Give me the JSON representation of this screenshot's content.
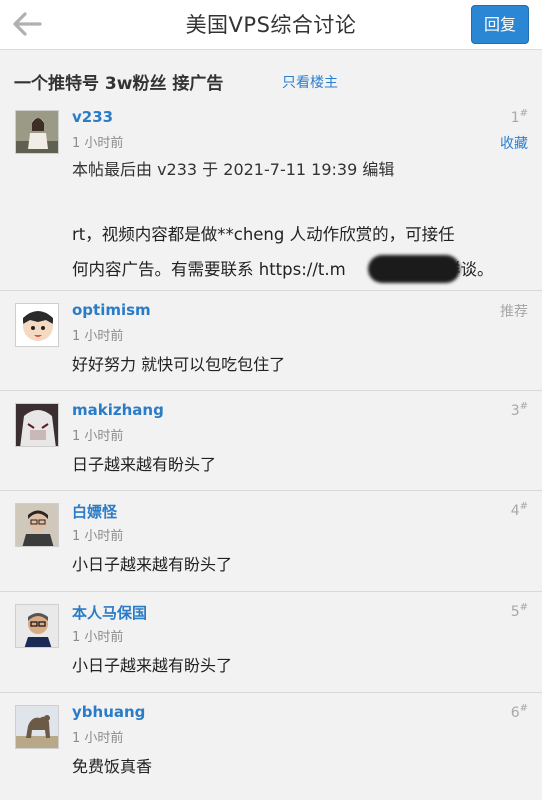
{
  "header": {
    "title": "美国VPS综合讨论",
    "reply_label": "回复",
    "back_icon": "back-arrow-icon"
  },
  "thread": {
    "title": "一个推特号 3w粉丝 接广告",
    "only_op_label": "只看楼主"
  },
  "posts": [
    {
      "author": "v233",
      "time": "1 小时前",
      "floor": "1",
      "action": "收藏",
      "edit_note": "本帖最后由 v233 于 2021-7-11 19:39 编辑",
      "body_line1": "rt，视频内容都是做**cheng 人动作欣赏的，可接任",
      "body_line2": "何内容广告。有需要联系 https://t.m",
      "body_line2_end": "详谈。"
    },
    {
      "author": "optimism",
      "time": "1 小时前",
      "floor": "推荐",
      "content": "好好努力 就快可以包吃包住了"
    },
    {
      "author": "makizhang",
      "time": "1 小时前",
      "floor": "3",
      "content": "日子越来越有盼头了"
    },
    {
      "author": "白嫖怪",
      "time": "1 小时前",
      "floor": "4",
      "content": "小日子越来越有盼头了"
    },
    {
      "author": "本人马保国",
      "time": "1 小时前",
      "floor": "5",
      "content": "小日子越来越有盼头了"
    },
    {
      "author": "ybhuang",
      "time": "1 小时前",
      "floor": "6",
      "content": "免费饭真香"
    }
  ],
  "floor_mark": "#",
  "colors": {
    "link": "#2a7cc7",
    "button": "#2b87d3",
    "background": "#f2f2f2"
  }
}
